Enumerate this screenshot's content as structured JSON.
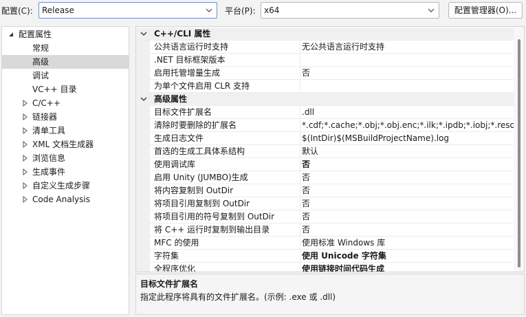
{
  "toolbar": {
    "config_label": "配置(C):",
    "config_value": "Release",
    "platform_label": "平台(P):",
    "platform_value": "x64",
    "config_manager_label": "配置管理器(O)..."
  },
  "tree": {
    "root": "配置属性",
    "items": [
      {
        "label": "常规",
        "expandable": false
      },
      {
        "label": "高级",
        "expandable": false,
        "selected": true
      },
      {
        "label": "调试",
        "expandable": false
      },
      {
        "label": "VC++ 目录",
        "expandable": false
      },
      {
        "label": "C/C++",
        "expandable": true
      },
      {
        "label": "链接器",
        "expandable": true
      },
      {
        "label": "清单工具",
        "expandable": true
      },
      {
        "label": "XML 文档生成器",
        "expandable": true
      },
      {
        "label": "浏览信息",
        "expandable": true
      },
      {
        "label": "生成事件",
        "expandable": true
      },
      {
        "label": "自定义生成步骤",
        "expandable": true
      },
      {
        "label": "Code Analysis",
        "expandable": true
      }
    ]
  },
  "grid": {
    "rows": [
      {
        "type": "header",
        "name": "C++/CLI 属性"
      },
      {
        "name": "公共语言运行时支持",
        "value": "无公共语言运行时支持"
      },
      {
        "name": ".NET 目标框架版本",
        "value": ""
      },
      {
        "name": "启用托管增量生成",
        "value": "否"
      },
      {
        "name": "为单个文件启用 CLR 支持",
        "value": ""
      },
      {
        "type": "header",
        "name": "高级属性"
      },
      {
        "name": "目标文件扩展名",
        "value": ".dll"
      },
      {
        "name": "清除时要删除的扩展名",
        "value": "*.cdf;*.cache;*.obj;*.obj.enc;*.ilk;*.ipdb;*.iobj;*.resources;"
      },
      {
        "name": "生成日志文件",
        "value": "$(IntDir)$(MSBuildProjectName).log"
      },
      {
        "name": "首选的生成工具体系结构",
        "value": "默认"
      },
      {
        "name": "使用调试库",
        "value": "否",
        "bold": true
      },
      {
        "name": "启用 Unity (JUMBO)生成",
        "value": "否"
      },
      {
        "name": "将内容复制到 OutDir",
        "value": "否"
      },
      {
        "name": "将项目引用复制到 OutDir",
        "value": "否"
      },
      {
        "name": "将项目引用的符号复制到 OutDir",
        "value": "否"
      },
      {
        "name": "将 C++ 运行时复制到输出目录",
        "value": "否"
      },
      {
        "name": "MFC 的使用",
        "value": "使用标准 Windows 库"
      },
      {
        "name": "字符集",
        "value": "使用 Unicode 字符集",
        "bold": true
      },
      {
        "name": "全程序优化",
        "value": "使用链接时间代码生成",
        "bold": true
      }
    ]
  },
  "description": {
    "title": "目标文件扩展名",
    "text": "指定此程序将具有的文件扩展名。(示例: .exe 或 .dll)"
  }
}
